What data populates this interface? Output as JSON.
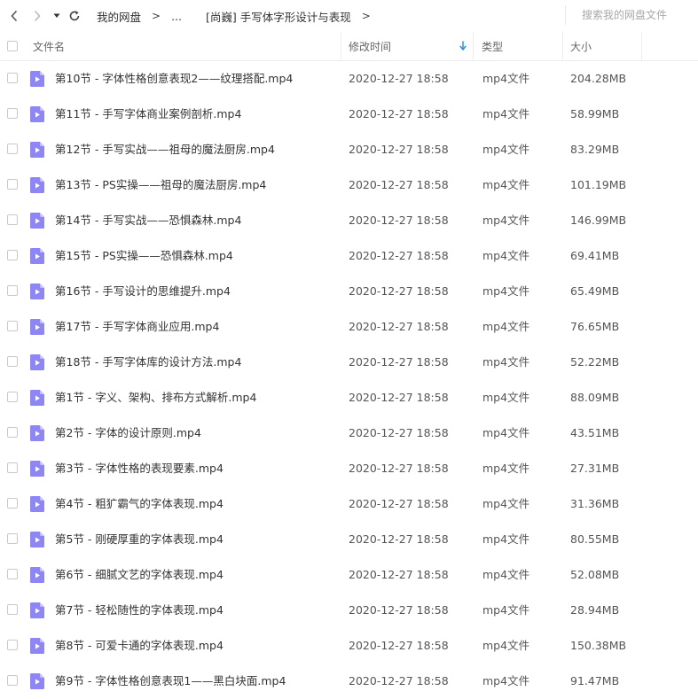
{
  "nav": {
    "breadcrumbs": [
      "我的网盘",
      "...",
      "[尚巍] 手写体字形设计与表现"
    ],
    "separator": ">"
  },
  "search": {
    "placeholder": "搜索我的网盘文件"
  },
  "columns": {
    "name": "文件名",
    "modified": "修改时间",
    "type": "类型",
    "size": "大小"
  },
  "colors": {
    "icon_bg": "#8f86f6",
    "icon_fold": "#c8c2ff",
    "sort_arrow": "#2b8cf0"
  },
  "files": [
    {
      "name": "第10节 - 字体性格创意表现2——纹理搭配.mp4",
      "modified": "2020-12-27 18:58",
      "type": "mp4文件",
      "size": "204.28MB"
    },
    {
      "name": "第11节 - 手写字体商业案例剖析.mp4",
      "modified": "2020-12-27 18:58",
      "type": "mp4文件",
      "size": "58.99MB"
    },
    {
      "name": "第12节 - 手写实战——祖母的魔法厨房.mp4",
      "modified": "2020-12-27 18:58",
      "type": "mp4文件",
      "size": "83.29MB"
    },
    {
      "name": "第13节 - PS实操——祖母的魔法厨房.mp4",
      "modified": "2020-12-27 18:58",
      "type": "mp4文件",
      "size": "101.19MB"
    },
    {
      "name": "第14节 - 手写实战——恐惧森林.mp4",
      "modified": "2020-12-27 18:58",
      "type": "mp4文件",
      "size": "146.99MB"
    },
    {
      "name": "第15节 - PS实操——恐惧森林.mp4",
      "modified": "2020-12-27 18:58",
      "type": "mp4文件",
      "size": "69.41MB"
    },
    {
      "name": "第16节 - 手写设计的思维提升.mp4",
      "modified": "2020-12-27 18:58",
      "type": "mp4文件",
      "size": "65.49MB"
    },
    {
      "name": "第17节 - 手写字体商业应用.mp4",
      "modified": "2020-12-27 18:58",
      "type": "mp4文件",
      "size": "76.65MB"
    },
    {
      "name": "第18节 - 手写字体库的设计方法.mp4",
      "modified": "2020-12-27 18:58",
      "type": "mp4文件",
      "size": "52.22MB"
    },
    {
      "name": "第1节 - 字义、架构、排布方式解析.mp4",
      "modified": "2020-12-27 18:58",
      "type": "mp4文件",
      "size": "88.09MB"
    },
    {
      "name": "第2节 - 字体的设计原则.mp4",
      "modified": "2020-12-27 18:58",
      "type": "mp4文件",
      "size": "43.51MB"
    },
    {
      "name": "第3节 - 字体性格的表现要素.mp4",
      "modified": "2020-12-27 18:58",
      "type": "mp4文件",
      "size": "27.31MB"
    },
    {
      "name": "第4节 - 粗犷霸气的字体表现.mp4",
      "modified": "2020-12-27 18:58",
      "type": "mp4文件",
      "size": "31.36MB"
    },
    {
      "name": "第5节 - 刚硬厚重的字体表现.mp4",
      "modified": "2020-12-27 18:58",
      "type": "mp4文件",
      "size": "80.55MB"
    },
    {
      "name": "第6节 - 细腻文艺的字体表现.mp4",
      "modified": "2020-12-27 18:58",
      "type": "mp4文件",
      "size": "52.08MB"
    },
    {
      "name": "第7节 - 轻松随性的字体表现.mp4",
      "modified": "2020-12-27 18:58",
      "type": "mp4文件",
      "size": "28.94MB"
    },
    {
      "name": "第8节 - 可爱卡通的字体表现.mp4",
      "modified": "2020-12-27 18:58",
      "type": "mp4文件",
      "size": "150.38MB"
    },
    {
      "name": "第9节 - 字体性格创意表现1——黑白块面.mp4",
      "modified": "2020-12-27 18:58",
      "type": "mp4文件",
      "size": "91.47MB"
    }
  ]
}
